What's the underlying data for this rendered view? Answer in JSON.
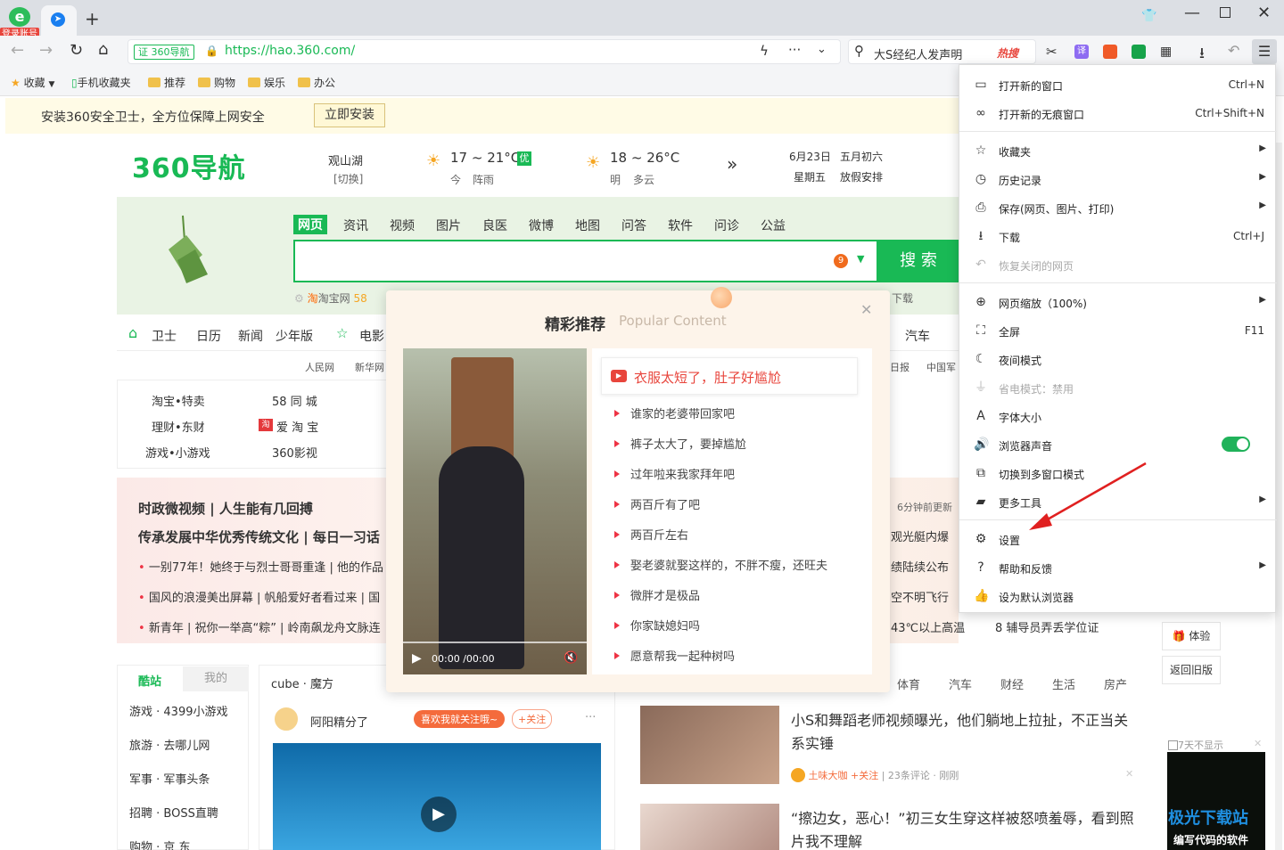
{
  "browser": {
    "login_badge": "登录账号",
    "new_tab": "+",
    "address": {
      "badge": "360导航",
      "url": "https://hao.360.com/"
    },
    "search_box": {
      "text": "大S经纪人发声明",
      "hot_label": "热搜"
    },
    "bookmarks": [
      "收藏",
      "手机收藏夹",
      "推荐",
      "购物",
      "娱乐",
      "办公"
    ]
  },
  "menu": {
    "items": [
      {
        "label": "打开新的窗口",
        "shortcut": "Ctrl+N"
      },
      {
        "label": "打开新的无痕窗口",
        "shortcut": "Ctrl+Shift+N"
      },
      {
        "label": "收藏夹"
      },
      {
        "label": "历史记录"
      },
      {
        "label": "保存(网页、图片、打印)"
      },
      {
        "label": "下载",
        "shortcut": "Ctrl+J"
      },
      {
        "label": "恢复关闭的网页"
      },
      {
        "label": "网页缩放（100%)"
      },
      {
        "label": "全屏",
        "shortcut": "F11"
      },
      {
        "label": "夜间模式"
      },
      {
        "label": "省电模式：禁用"
      },
      {
        "label": "字体大小"
      },
      {
        "label": "浏览器声音"
      },
      {
        "label": "切换到多窗口模式"
      },
      {
        "label": "更多工具"
      },
      {
        "label": "设置"
      },
      {
        "label": "帮助和反馈"
      },
      {
        "label": "设为默认浏览器"
      }
    ]
  },
  "page": {
    "notice": {
      "text": "安装360安全卫士，全方位保障上网安全",
      "button": "立即安装"
    },
    "logo": "360导航",
    "location": {
      "city": "观山湖",
      "switch": "[切换]"
    },
    "weather_today": {
      "temp": "17 ~ 21°C",
      "badge": "优",
      "day": "今",
      "desc": "阵雨"
    },
    "weather_tomorrow": {
      "temp": "18 ~ 26°C",
      "day": "明",
      "desc": "多云"
    },
    "date": {
      "solar": "6月23日",
      "lunar": "五月初六",
      "weekday": "星期五",
      "holiday": "放假安排"
    },
    "search_tabs": [
      "网页",
      "资讯",
      "视频",
      "图片",
      "良医",
      "微博",
      "地图",
      "问答",
      "软件",
      "问诊",
      "公益"
    ],
    "search_button": "搜 索",
    "search_badge": "9",
    "hot_links": [
      "淘宝网",
      "58"
    ],
    "download_text": "下载",
    "nav_row": [
      "卫士",
      "日历",
      "新闻",
      "少年版",
      "电影",
      "汽车"
    ],
    "sub_links": [
      "人民网",
      "新华网",
      "日报",
      "中国军"
    ],
    "grid_links": [
      [
        "淘宝•特卖",
        "58 同 城"
      ],
      [
        "理财•东财",
        "爱 淘 宝"
      ],
      [
        "游戏•小游戏",
        "360影视"
      ]
    ],
    "news_heading1": "时政微视频 | 人生能有几回搏",
    "news_heading2": "传承发展中华优秀传统文化 | 每日一习话",
    "news_items": [
      "一别77年！她终于与烈士哥哥重逢 | 他的作品",
      "国风的浪漫美出屏幕 | 帆船爱好者看过来 | 国",
      "新青年 | 祝你一举高“粽” | 岭南飙龙舟文脉连"
    ],
    "right_news": {
      "update": "6分钟前更新",
      "items": [
        "观光艇内爆",
        "绩陆续公布",
        "空不明飞行",
        "43℃以上高温",
        "8  辅导员弄丢学位证"
      ]
    },
    "left_panel": {
      "tabs": [
        "酷站",
        "我的"
      ],
      "items": [
        "游戏 · 4399小游戏",
        "旅游 · 去哪儿网",
        "军事 · 军事头条",
        "招聘 · BOSS直聘",
        "购物 · 京 东"
      ]
    },
    "cube": {
      "title": "cube · 魔方",
      "user": "阿阳精分了",
      "tag": "喜欢我就关注哦~",
      "follow": "+关注"
    },
    "feed_tabs": [
      "体育",
      "汽车",
      "财经",
      "生活",
      "房产"
    ],
    "feed": [
      {
        "title": "小S和舞蹈老师视频曝光，他们躺地上拉扯，不正当关系实锤",
        "source": "土味大咖",
        "follow": "+关注",
        "meta": "23条评论 · 刚刚"
      },
      {
        "title": "“擦边女，恶心！”初三女生穿这样被怒喷羞辱，看到照片我不理解",
        "source": "",
        "follow": "",
        "meta": ""
      }
    ],
    "side_buttons": [
      "体验",
      "返回旧版"
    ],
    "ad_close": "7天不显示",
    "watermark": "极光下载站",
    "watermark_sub": "编写代码的软件"
  },
  "popup": {
    "title": "精彩推荐",
    "subtitle": "Popular Content",
    "video_time": "00:00 /00:00",
    "headline": "衣服太短了，肚子好尴尬",
    "items": [
      "谁家的老婆带回家吧",
      "裤子太大了，要掉尴尬",
      "过年啦来我家拜年吧",
      "两百斤有了吧",
      "两百斤左右",
      "娶老婆就娶这样的，不胖不瘦，还旺夫",
      "微胖才是极品",
      "你家缺媳妇吗",
      "愿意帮我一起种树吗"
    ]
  },
  "colors": {
    "brand_green": "#19b955",
    "accent_red": "#e34",
    "menu_toggle": "#20b25a"
  }
}
